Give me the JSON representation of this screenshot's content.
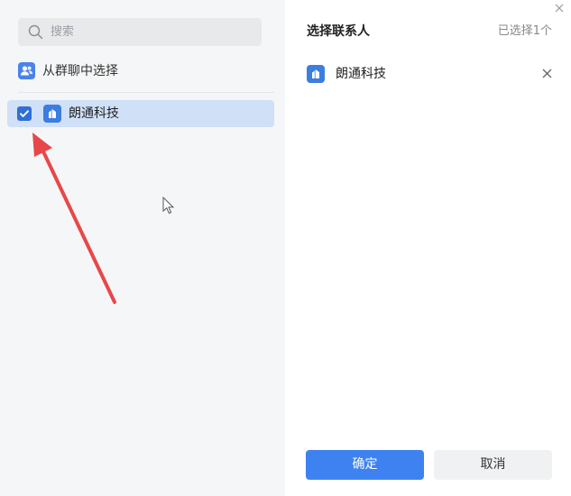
{
  "search": {
    "placeholder": "搜索",
    "icon": "search-icon"
  },
  "group_chat": {
    "label": "从群聊中选择",
    "icon": "group-users-icon"
  },
  "contacts": [
    {
      "label": "朗通科技",
      "checked": true,
      "icon": "company-icon"
    }
  ],
  "selection_panel": {
    "title": "选择联系人",
    "count_text": "已选择1个",
    "items": [
      {
        "label": "朗通科技",
        "icon": "company-icon"
      }
    ]
  },
  "buttons": {
    "confirm": "确定",
    "cancel": "取消"
  },
  "colors": {
    "primary": "#3d82f0",
    "selected_row": "#cfe0f7",
    "annotation_arrow": "#e8474a"
  }
}
